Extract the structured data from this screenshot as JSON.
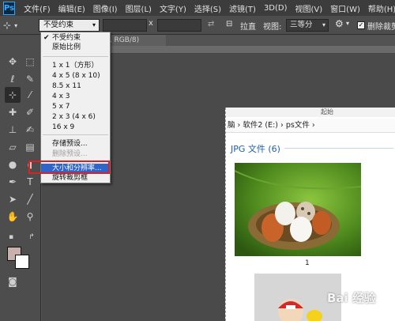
{
  "app": {
    "logo": "Ps"
  },
  "menubar": {
    "items": [
      "文件(F)",
      "编辑(E)",
      "图像(I)",
      "图层(L)",
      "文字(Y)",
      "选择(S)",
      "滤镜(T)",
      "3D(D)",
      "视图(V)",
      "窗口(W)",
      "帮助(H)"
    ]
  },
  "options": {
    "ratio_value": "不受约束",
    "x_sep": "x",
    "straighten_label": "拉直",
    "view_label": "视图:",
    "view_value": "三等分",
    "delete_pixels_label": "删除裁剪",
    "delete_pixels_checked": true
  },
  "document": {
    "tab_title": "0, RGB/8)"
  },
  "dropdown": {
    "items": [
      {
        "label": "不受约束",
        "checked": true,
        "state": "normal"
      },
      {
        "label": "原始比例",
        "state": "normal"
      },
      {
        "label": "1 x 1（方形）",
        "state": "normal"
      },
      {
        "label": "4 x 5 (8 x 10)",
        "state": "normal"
      },
      {
        "label": "8.5 x 11",
        "state": "normal"
      },
      {
        "label": "4 x 3",
        "state": "normal"
      },
      {
        "label": "5 x 7",
        "state": "normal"
      },
      {
        "label": "2 x 3 (4 x 6)",
        "state": "normal"
      },
      {
        "label": "16 x 9",
        "state": "normal"
      },
      {
        "label": "存储预设...",
        "state": "normal"
      },
      {
        "label": "删除预设...",
        "state": "disabled"
      },
      {
        "label": "大小和分辨率...",
        "state": "highlight"
      },
      {
        "label": "旋转裁剪框",
        "state": "normal"
      }
    ]
  },
  "explorer": {
    "title": "起始",
    "breadcrumb": "脑 › 软件2 (E:) › ps文件 ›",
    "group_heading": "JPG 文件 (6)",
    "thumb1_label": "1"
  },
  "watermark": "Bai 经验",
  "colors": {
    "foreground": "#c9b0ad",
    "background": "#ffffff",
    "highlight": "#2f65c8",
    "annotation": "#e02020"
  },
  "tools": [
    "move-tool",
    "marquee-tool",
    "lasso-tool",
    "quick-select-tool",
    "crop-tool",
    "eyedropper-tool",
    "healing-tool",
    "brush-tool",
    "stamp-tool",
    "history-brush-tool",
    "eraser-tool",
    "gradient-tool",
    "blur-tool",
    "dodge-tool",
    "pen-tool",
    "type-tool",
    "path-select-tool",
    "shape-tool",
    "hand-tool",
    "zoom-tool"
  ]
}
